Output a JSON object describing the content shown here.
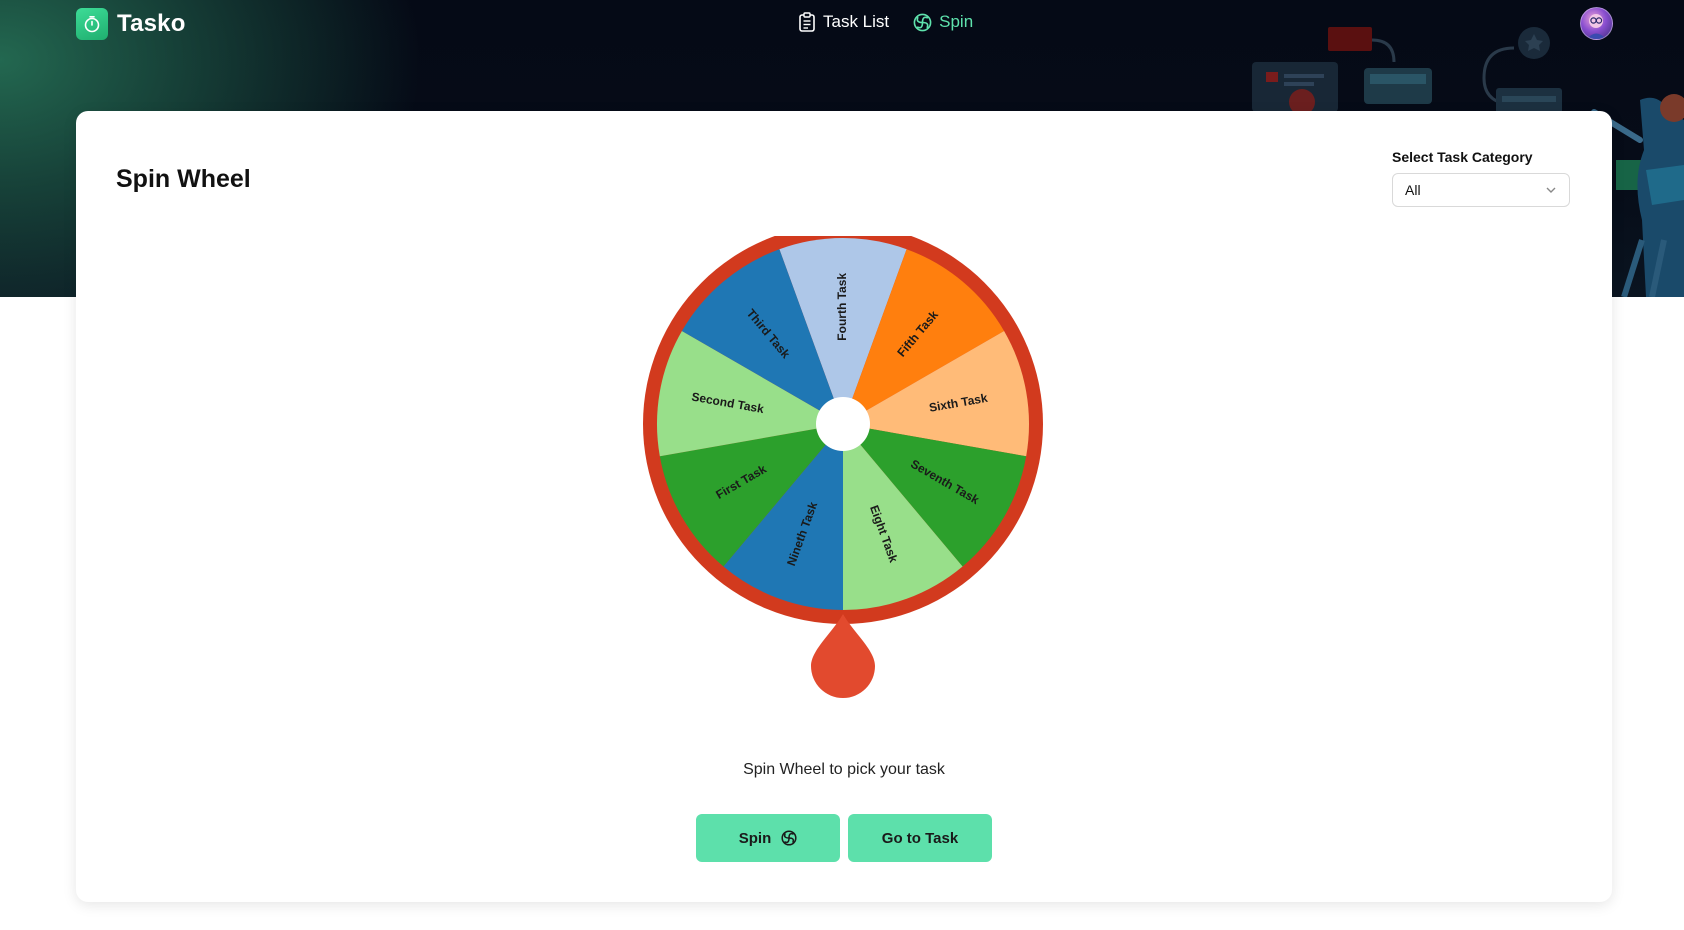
{
  "app": {
    "name": "Tasko"
  },
  "nav": {
    "task_list_label": "Task List",
    "spin_label": "Spin"
  },
  "page": {
    "title": "Spin Wheel"
  },
  "category": {
    "label": "Select Task Category",
    "selected": "All"
  },
  "wheel": {
    "segments": [
      {
        "label": "Fourth Task",
        "color": "#aec7e8"
      },
      {
        "label": "Fifth Task",
        "color": "#ff7f0e"
      },
      {
        "label": "Sixth Task",
        "color": "#ffbb78"
      },
      {
        "label": "Seventh Task",
        "color": "#2ca02c"
      },
      {
        "label": "Eight Task",
        "color": "#98df8a"
      },
      {
        "label": "Nineth Task",
        "color": "#1f77b4"
      },
      {
        "label": "First Task",
        "color": "#2ca02c"
      },
      {
        "label": "Second Task",
        "color": "#98df8a"
      },
      {
        "label": "Third Task",
        "color": "#1f77b4"
      }
    ],
    "rim_color": "#d23a1e",
    "pointer_color": "#e24a2e"
  },
  "caption": "Spin Wheel to pick your task",
  "buttons": {
    "spin_label": "Spin",
    "go_label": "Go to Task"
  },
  "colors": {
    "accent": "#5de0ab",
    "nav_active": "#5fe3ad"
  }
}
